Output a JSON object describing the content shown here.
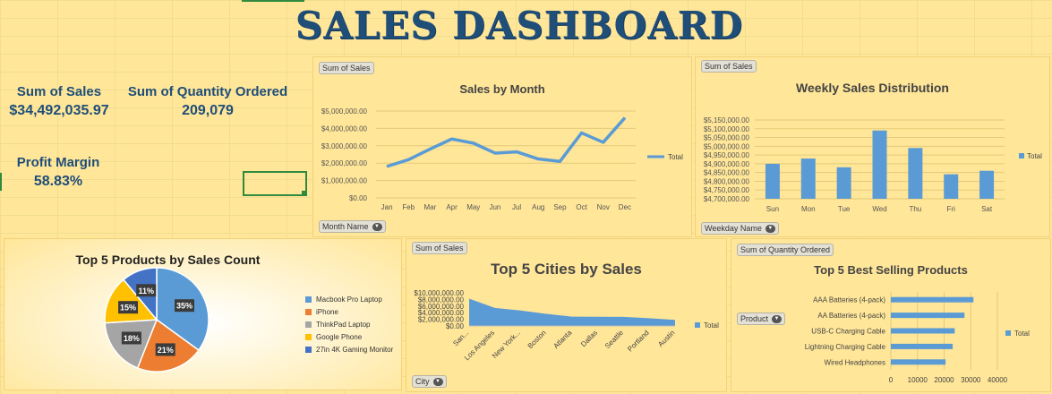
{
  "dashboard": {
    "title": "SALES DASHBOARD"
  },
  "kpis": {
    "sum_sales_label": "Sum of Sales",
    "sum_sales_value": "$34,492,035.97",
    "qty_label": "Sum of Quantity Ordered",
    "qty_value": "209,079",
    "margin_label": "Profit Margin",
    "margin_value": "58.83%"
  },
  "colors": {
    "accent_blue": "#5b9bd5",
    "orange": "#ed7d31",
    "gray": "#a5a5a5",
    "gold": "#ffc000",
    "dark_blue": "#4472c4",
    "title_navy": "#1f4e79",
    "background": "#ffe699"
  },
  "month_chart": {
    "field_button": "Sum of Sales",
    "filter_button": "Month Name",
    "legend": "Total"
  },
  "weekday_chart": {
    "field_button": "Sum of Sales",
    "filter_button": "Weekday Name",
    "legend": "Total"
  },
  "pie_chart": {},
  "city_chart": {
    "field_button": "Sum of Sales",
    "filter_button": "City",
    "legend": "Total"
  },
  "products_chart": {
    "field_button": "Sum of Quantity Ordered",
    "filter_button": "Product",
    "legend": "Total"
  },
  "chart_data": [
    {
      "type": "line",
      "title": "Sales by Month",
      "categories": [
        "Jan",
        "Feb",
        "Mar",
        "Apr",
        "May",
        "Jun",
        "Jul",
        "Aug",
        "Sep",
        "Oct",
        "Nov",
        "Dec"
      ],
      "series": [
        {
          "name": "Total",
          "values": [
            1810000,
            2200000,
            2810000,
            3390000,
            3150000,
            2580000,
            2650000,
            2240000,
            2100000,
            3740000,
            3200000,
            4610000
          ]
        }
      ],
      "ylim": [
        0,
        5000000
      ],
      "yticks": [
        "$0.00",
        "$1,000,000.00",
        "$2,000,000.00",
        "$3,000,000.00",
        "$4,000,000.00",
        "$5,000,000.00"
      ],
      "grid": true,
      "legend": "right"
    },
    {
      "type": "bar",
      "title": "Weekly Sales Distribution",
      "categories": [
        "Sun",
        "Mon",
        "Tue",
        "Wed",
        "Thu",
        "Fri",
        "Sat"
      ],
      "series": [
        {
          "name": "Total",
          "values": [
            4900000,
            4930000,
            4880000,
            5090000,
            4990000,
            4840000,
            4860000
          ]
        }
      ],
      "ylim": [
        4700000,
        5150000
      ],
      "yticks": [
        "$4,700,000.00",
        "$4,750,000.00",
        "$4,800,000.00",
        "$4,850,000.00",
        "$4,900,000.00",
        "$4,950,000.00",
        "$5,000,000.00",
        "$5,050,000.00",
        "$5,100,000.00",
        "$5,150,000.00"
      ],
      "grid": true,
      "legend": "right"
    },
    {
      "type": "pie",
      "title": "Top 5 Products by Sales Count",
      "categories": [
        "Macbook Pro Laptop",
        "iPhone",
        "ThinkPad Laptop",
        "Google Phone",
        "27in 4K Gaming Monitor"
      ],
      "values": [
        35,
        21,
        18,
        15,
        11
      ],
      "labels": [
        "35%",
        "21%",
        "18%",
        "15%",
        "11%"
      ],
      "legend": "right"
    },
    {
      "type": "area",
      "title": "Top 5 Cities by Sales",
      "categories": [
        "San...",
        "Los Angeles",
        "New York...",
        "Boston",
        "Atlanta",
        "Dallas",
        "Seattle",
        "Portland",
        "Austin"
      ],
      "series": [
        {
          "name": "Total",
          "values": [
            8260000,
            5450000,
            4660000,
            3660000,
            2800000,
            2770000,
            2750000,
            2320000,
            1820000
          ]
        }
      ],
      "ylim": [
        0,
        10000000
      ],
      "yticks": [
        "$0.00",
        "$2,000,000.00",
        "$4,000,000.00",
        "$6,000,000.00",
        "$8,000,000.00",
        "$10,000,000.00"
      ],
      "legend": "right"
    },
    {
      "type": "bar",
      "orientation": "horizontal",
      "title": "Top 5 Best Selling Products",
      "categories": [
        "AAA Batteries (4-pack)",
        "AA Batteries (4-pack)",
        "USB-C Charging Cable",
        "Lightning Charging Cable",
        "Wired Headphones"
      ],
      "series": [
        {
          "name": "Total",
          "values": [
            31017,
            27635,
            23975,
            23217,
            20557
          ]
        }
      ],
      "xlim": [
        0,
        40000
      ],
      "xticks": [
        "0",
        "10000",
        "20000",
        "30000",
        "40000"
      ],
      "legend": "right"
    }
  ]
}
